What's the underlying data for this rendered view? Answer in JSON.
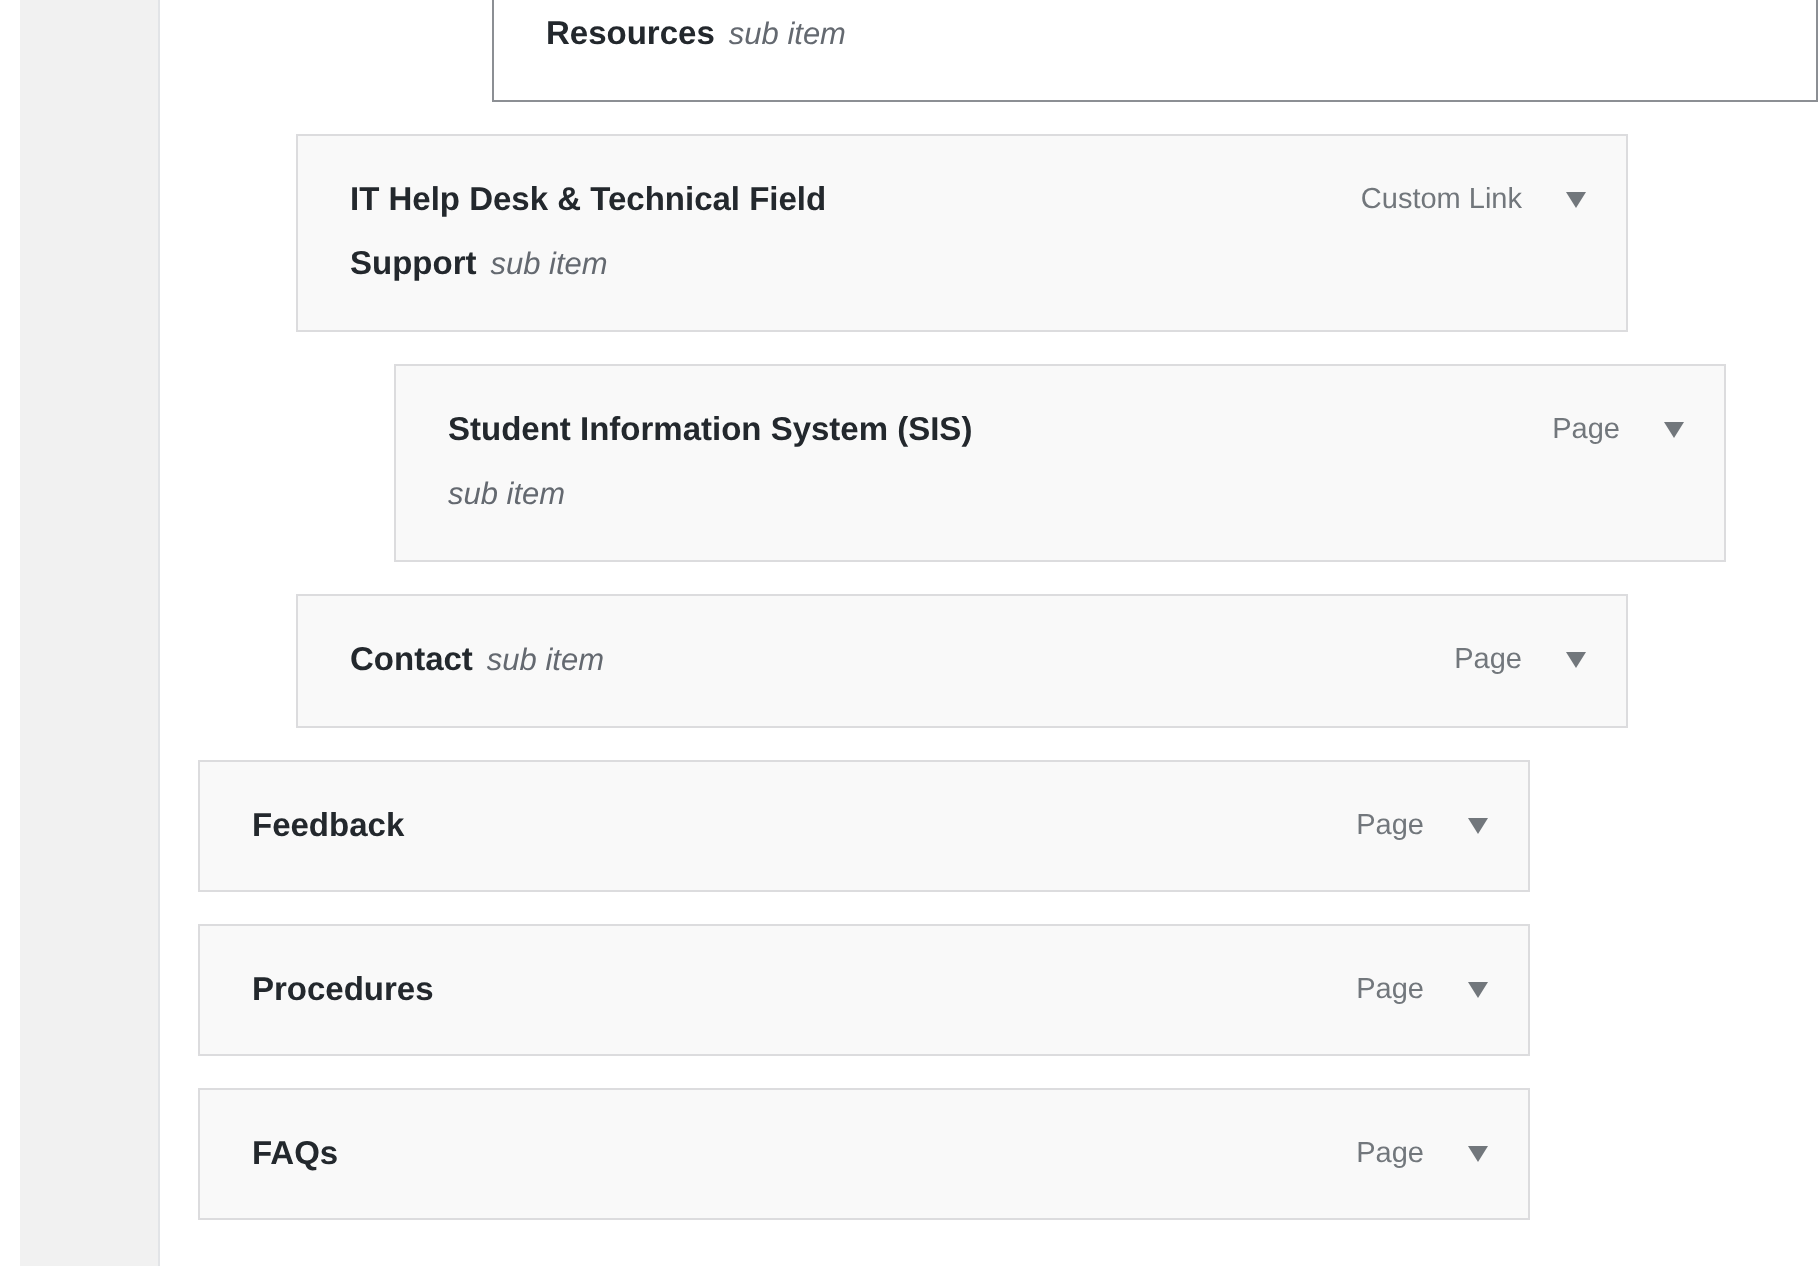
{
  "menu_items": [
    {
      "children": [
        {
          "children": [
            {
              "children": [
                {
                  "title": "Resources",
                  "note": "sub item",
                  "dragging": true
                }
              ]
            }
          ]
        },
        {
          "title": "IT Help Desk & Technical Field Support",
          "note": "sub item",
          "type": "Custom Link",
          "dragging": false,
          "children": [
            {
              "title": "Student Information System (SIS)",
              "note": "sub item",
              "type": "Page",
              "dragging": false
            }
          ]
        },
        {
          "title": "Contact",
          "note": "sub item",
          "type": "Page",
          "dragging": false
        }
      ]
    },
    {
      "title": "Feedback",
      "type": "Page",
      "dragging": false
    },
    {
      "title": "Procedures",
      "type": "Page",
      "dragging": false
    },
    {
      "title": "FAQs",
      "type": "Page",
      "dragging": false
    }
  ]
}
